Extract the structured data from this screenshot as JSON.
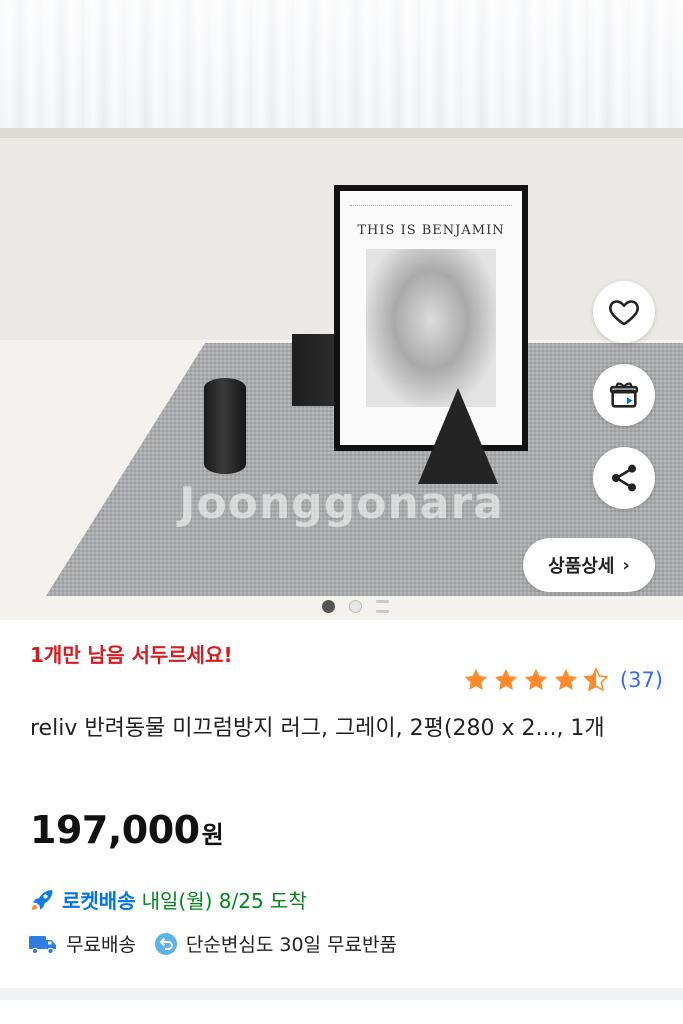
{
  "product_image": {
    "poster_title": "THIS   IS BENJAMIN",
    "watermark": "Joonggonara",
    "detail_button_label": "상품상세",
    "detail_button_chevron": "›",
    "actions": [
      {
        "name": "like",
        "icon": "heart-icon"
      },
      {
        "name": "gift",
        "icon": "gift-icon"
      },
      {
        "name": "share",
        "icon": "share-icon"
      }
    ],
    "pager": {
      "total_dots": 2,
      "active_index": 0,
      "has_more": true
    }
  },
  "stock_notice": "1개만 남음 서두르세요!",
  "rating": {
    "stars": 4.5,
    "max": 5,
    "review_count": "(37)"
  },
  "title": "reliv 반려동물 미끄럼방지 러그, 그레이, 2평(280 x 2..., 1개",
  "price": {
    "amount": "197,000",
    "unit": "원"
  },
  "delivery": {
    "label": "로켓배송",
    "eta": "내일(월) 8/25 도착",
    "icon": "rocket-icon"
  },
  "perks": [
    {
      "icon": "truck-icon",
      "label": "무료배송"
    },
    {
      "icon": "return-icon",
      "label": "단순변심도 30일 무료반품"
    }
  ],
  "colors": {
    "stock": "#d81b21",
    "rocket": "#0073e9",
    "eta": "#00891a",
    "star": "#ff8a2b",
    "review": "#346aff"
  }
}
